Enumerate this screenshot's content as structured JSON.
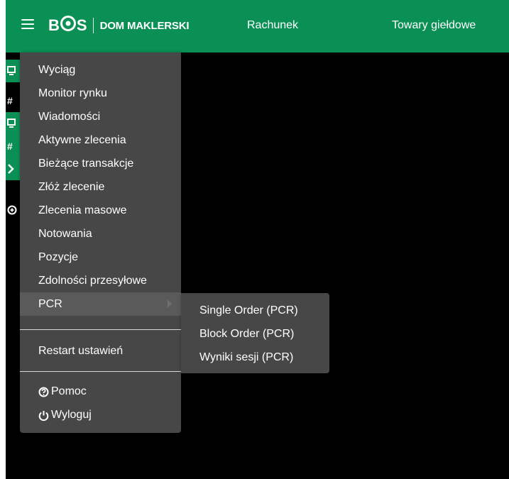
{
  "colors": {
    "brand_green": "#0a8f54",
    "menu_bg": "#474747",
    "active_bg": "#5a5a5a",
    "background": "#000000"
  },
  "header": {
    "logo_text": "DOM MAKLERSKI",
    "logo_brand": "BOS",
    "nav": [
      "Rachunek",
      "Towary giełdowe"
    ]
  },
  "side_rows": [
    {
      "icon": "monitor-icon"
    },
    {
      "icon": "hash-icon",
      "text": "#"
    },
    {
      "icon": "monitor-icon"
    },
    {
      "icon": "hash-icon",
      "text": "#"
    },
    {
      "icon": "chevron-right-icon"
    },
    {
      "icon": "plus-circle-icon"
    }
  ],
  "menu": {
    "items": [
      "Wyciąg",
      "Monitor rynku",
      "Wiadomości",
      "Aktywne zlecenia",
      "Bieżące transakcje",
      "Złóż zlecenie",
      "Zlecenia masowe",
      "Notowania",
      "Pozycje",
      "Zdolności przesyłowe",
      "PCR"
    ],
    "active_item": "PCR",
    "restart": "Restart ustawień",
    "help": "Pomoc",
    "logout": "Wyloguj"
  },
  "submenu": {
    "items": [
      "Single Order (PCR)",
      "Block Order (PCR)",
      "Wyniki sesji (PCR)"
    ]
  }
}
